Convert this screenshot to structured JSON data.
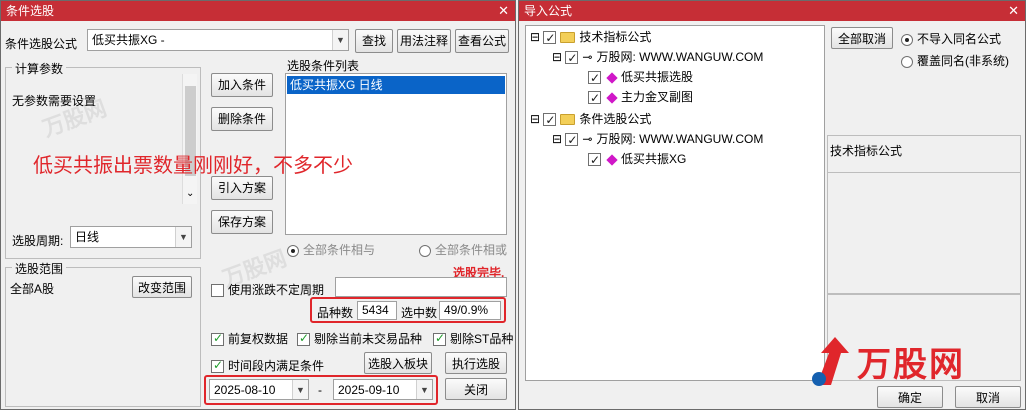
{
  "left_window": {
    "title": "条件选股",
    "formula_label": "条件选股公式",
    "formula_value": "低买共振XG  -",
    "btn_find": "查找",
    "btn_usage": "用法注释",
    "btn_view": "查看公式",
    "calc_params_title": "计算参数",
    "calc_params_text": "无参数需要设置",
    "period_label": "选股周期:",
    "period_value": "日线",
    "cond_list_title": "选股条件列表",
    "cond_list_item": "低买共振XG  日线",
    "btn_add": "加入条件",
    "btn_delete": "删除条件",
    "btn_import": "引入方案",
    "btn_save": "保存方案",
    "radio_all_and": "全部条件相与",
    "radio_all_or": "全部条件相或",
    "status_done": "选股完毕.",
    "overlay_text": "低买共振出票数量刚刚好，不多不少",
    "range_title": "选股范围",
    "range_value": "全部A股",
    "btn_change_range": "改变范围",
    "use_period_label": "使用涨跌不定周期",
    "count_label": "品种数",
    "count_value": "5434",
    "selected_label": "选中数",
    "selected_value": "49/0.9%",
    "chk_prefq": "前复权数据",
    "chk_remove_notrade": "剔除当前未交易品种",
    "chk_remove_st": "剔除ST品种",
    "chk_time_period": "时间段内满足条件",
    "btn_to_block": "选股入板块",
    "btn_execute": "执行选股",
    "date_from": "2025-08-10",
    "date_sep": "-",
    "date_to": "2025-09-10",
    "btn_close": "关闭"
  },
  "right_window": {
    "title": "导入公式",
    "tree": {
      "tech_folder": "技术指标公式",
      "tech_site": "万股网: WWW.WANGUW.COM",
      "tech_item1": "低买共振选股",
      "tech_item2": "主力金叉副图",
      "cond_folder": "条件选股公式",
      "cond_site": "万股网: WWW.WANGUW.COM",
      "cond_item1": "低买共振XG"
    },
    "btn_cancel_all": "全部取消",
    "radio_no_import": "不导入同名公式",
    "radio_overwrite": "覆盖同名(非系统)",
    "info_label": "技术指标公式",
    "btn_ok": "确定",
    "btn_cancel": "取消"
  },
  "logo_text": "万股网",
  "colors": {
    "titlebar": "#c62e36",
    "highlight": "#0a64c8",
    "annotation_red": "#e0262b"
  }
}
